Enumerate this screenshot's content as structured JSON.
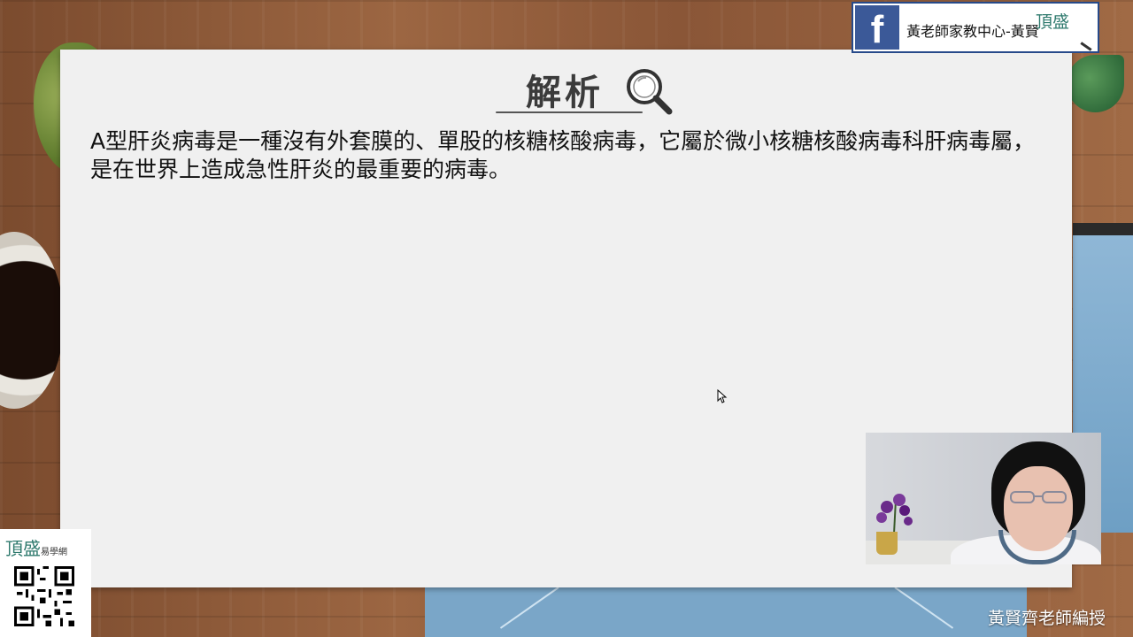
{
  "slide": {
    "title": "解析",
    "body": "A型肝炎病毒是一種沒有外套膜的、單股的核糖核酸病毒，它屬於微小核糖核酸病毒科肝病毒屬，是在世界上造成急性肝炎的最重要的病毒。"
  },
  "facebook_banner": {
    "logo_letter": "f",
    "page_name": "黃老師家教中心-黃賢",
    "brand": "頂盛"
  },
  "qr_badge": {
    "brand": "頂盛",
    "brand_suffix": "易學網"
  },
  "caption": "黃賢齊老師編授",
  "icons": [
    "magnifier-icon",
    "facebook-icon",
    "qr-code",
    "cursor-icon"
  ],
  "colors": {
    "facebook": "#3b5998",
    "brand_green": "#2f7a6e",
    "slide_bg": "#f0f0f0"
  }
}
